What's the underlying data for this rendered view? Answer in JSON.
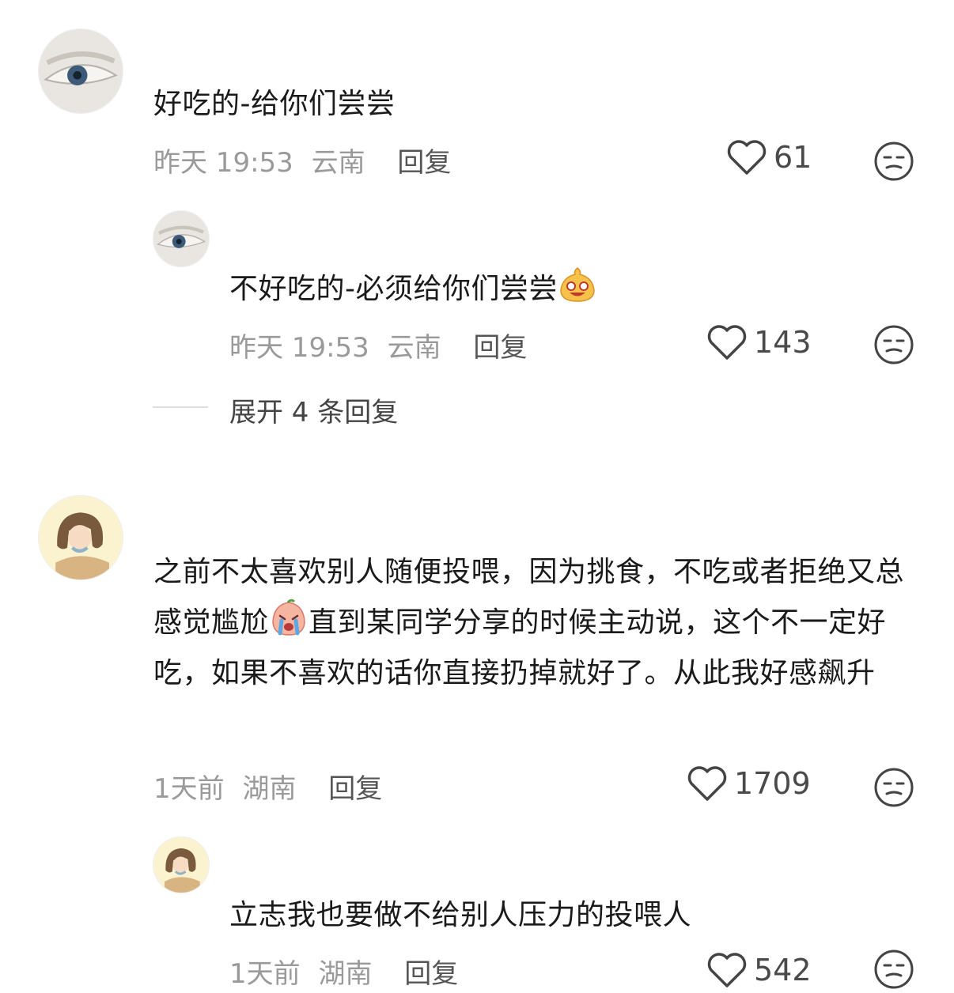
{
  "comments": [
    {
      "text": "好吃的-给你们尝尝",
      "time": "昨天 19:53",
      "location": "云南",
      "reply_label": "回复",
      "likes": "61",
      "reply": {
        "text": "不好吃的-必须给你们尝尝",
        "emoji_icon": "grinning-face-emoji",
        "time": "昨天 19:53",
        "location": "云南",
        "reply_label": "回复",
        "likes": "143"
      },
      "expand_label": "展开 4 条回复"
    },
    {
      "text_part1": "之前不太喜欢别人随便投喂，因为挑食，不吃或者拒绝又总感觉尴尬",
      "emoji_icon": "crying-face-emoji",
      "text_part2": "直到某同学分享的时候主动说，这个不一定好吃，如果不喜欢的话你直接扔掉就好了。从此我好感飙升",
      "time": "1天前",
      "location": "湖南",
      "reply_label": "回复",
      "likes": "1709",
      "reply": {
        "text": "立志我也要做不给别人压力的投喂人",
        "time": "1天前",
        "location": "湖南",
        "reply_label": "回复",
        "likes": "542"
      }
    }
  ]
}
